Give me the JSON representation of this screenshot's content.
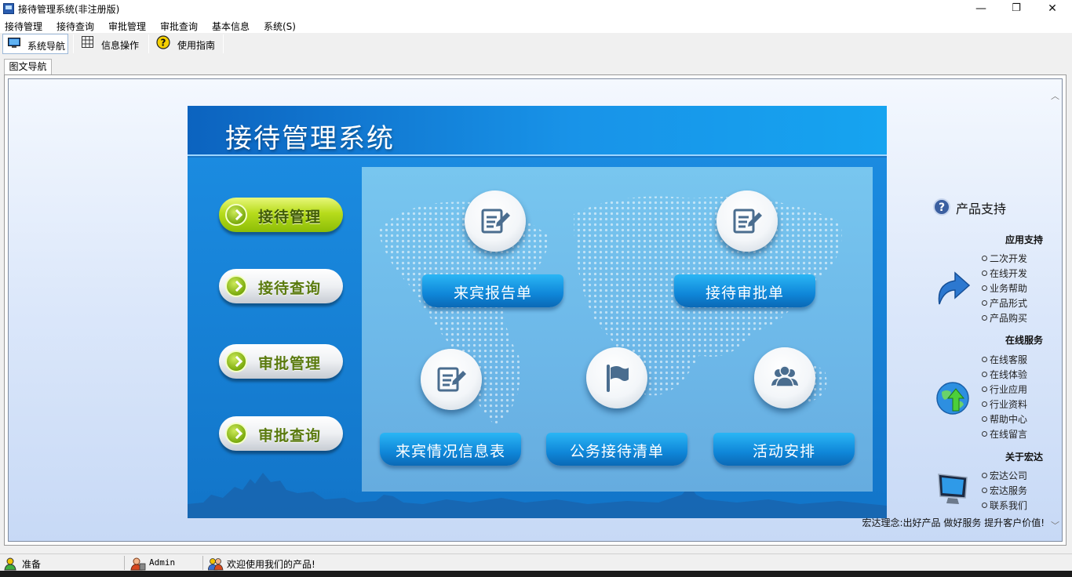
{
  "window": {
    "title": "接待管理系统(非注册版)",
    "minimize_glyph": "—",
    "maximize_glyph": "❐",
    "close_glyph": "✕"
  },
  "menu": {
    "items": [
      "接待管理",
      "接待查询",
      "审批管理",
      "审批查询",
      "基本信息",
      "系统(S)"
    ]
  },
  "toolbar": {
    "items": [
      {
        "label": "系统导航",
        "icon": "monitor-icon"
      },
      {
        "label": "信息操作",
        "icon": "grid-icon"
      },
      {
        "label": "使用指南",
        "icon": "help-icon"
      }
    ]
  },
  "tabs": {
    "active": "图文导航"
  },
  "banner": {
    "title": "接待管理系统",
    "nav_buttons": [
      "接待管理",
      "接待查询",
      "审批管理",
      "审批查询"
    ],
    "tiles": [
      {
        "label": "来宾报告单",
        "icon": "document-edit-icon"
      },
      {
        "label": "接待审批单",
        "icon": "document-edit-icon"
      },
      {
        "label": "来宾情况信息表",
        "icon": "document-edit-icon"
      },
      {
        "label": "公务接待清单",
        "icon": "flag-icon"
      },
      {
        "label": "活动安排",
        "icon": "people-icon"
      }
    ]
  },
  "sidebar": {
    "heading": "产品支持",
    "sections": [
      {
        "title": "应用支持",
        "links": [
          "二次开发",
          "在线开发",
          "业务帮助",
          "产品形式",
          "产品购买"
        ]
      },
      {
        "title": "在线服务",
        "links": [
          "在线客服",
          "在线体验",
          "行业应用",
          "行业资料",
          "帮助中心",
          "在线留言"
        ]
      },
      {
        "title": "关于宏达",
        "links": [
          "宏达公司",
          "宏达服务",
          "联系我们"
        ]
      }
    ],
    "slogan": "宏达理念:出好产品  做好服务  提升客户价值!"
  },
  "status": {
    "state": "准备",
    "user": "Admin",
    "message": "欢迎使用我们的产品!"
  },
  "colors": {
    "banner_blue": "#1976c6",
    "button_green": "#b7dc1c",
    "panel_bg": "#dbe7fa"
  }
}
